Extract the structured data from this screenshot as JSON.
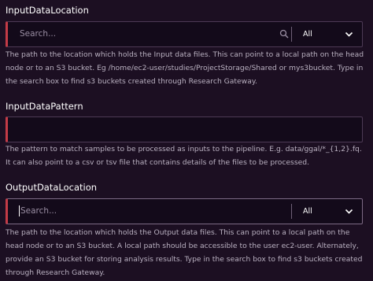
{
  "fields": [
    {
      "label": "InputDataLocation",
      "search_placeholder": "Search...",
      "select_value": "All",
      "help": "The path to the location which holds the Input data files. This can point to a local path on the head node or to an S3 bucket. Eg /home/ec2-user/studies/ProjectStorage/Shared or mys3bucket. Type in the search box to find s3 buckets created through Research Gateway."
    },
    {
      "label": "InputDataPattern",
      "value": "",
      "help": "The pattern to match samples to be processed as inputs to the pipeline. E.g. data/ggal/*_{1,2}.fq. It can also point to a csv or tsv file that contains details of the files to be processed."
    },
    {
      "label": "OutputDataLocation",
      "search_placeholder": "Search...",
      "select_value": "All",
      "help": "The path to the location which holds the Output data files. This can point to a local path on the head node or to an S3 bucket. A local path should be accessible to the user ec2-user. Alternately, provide an S3 bucket for storing analysis results. Type in the search box to find s3 buckets created through Research Gateway."
    }
  ],
  "colors": {
    "background": "#1c0f22",
    "input_background": "#130a1a",
    "accent_bar": "#c43b47",
    "help_text": "#b9b0c0"
  },
  "icons": [
    "search-icon",
    "chevron-down-icon"
  ]
}
